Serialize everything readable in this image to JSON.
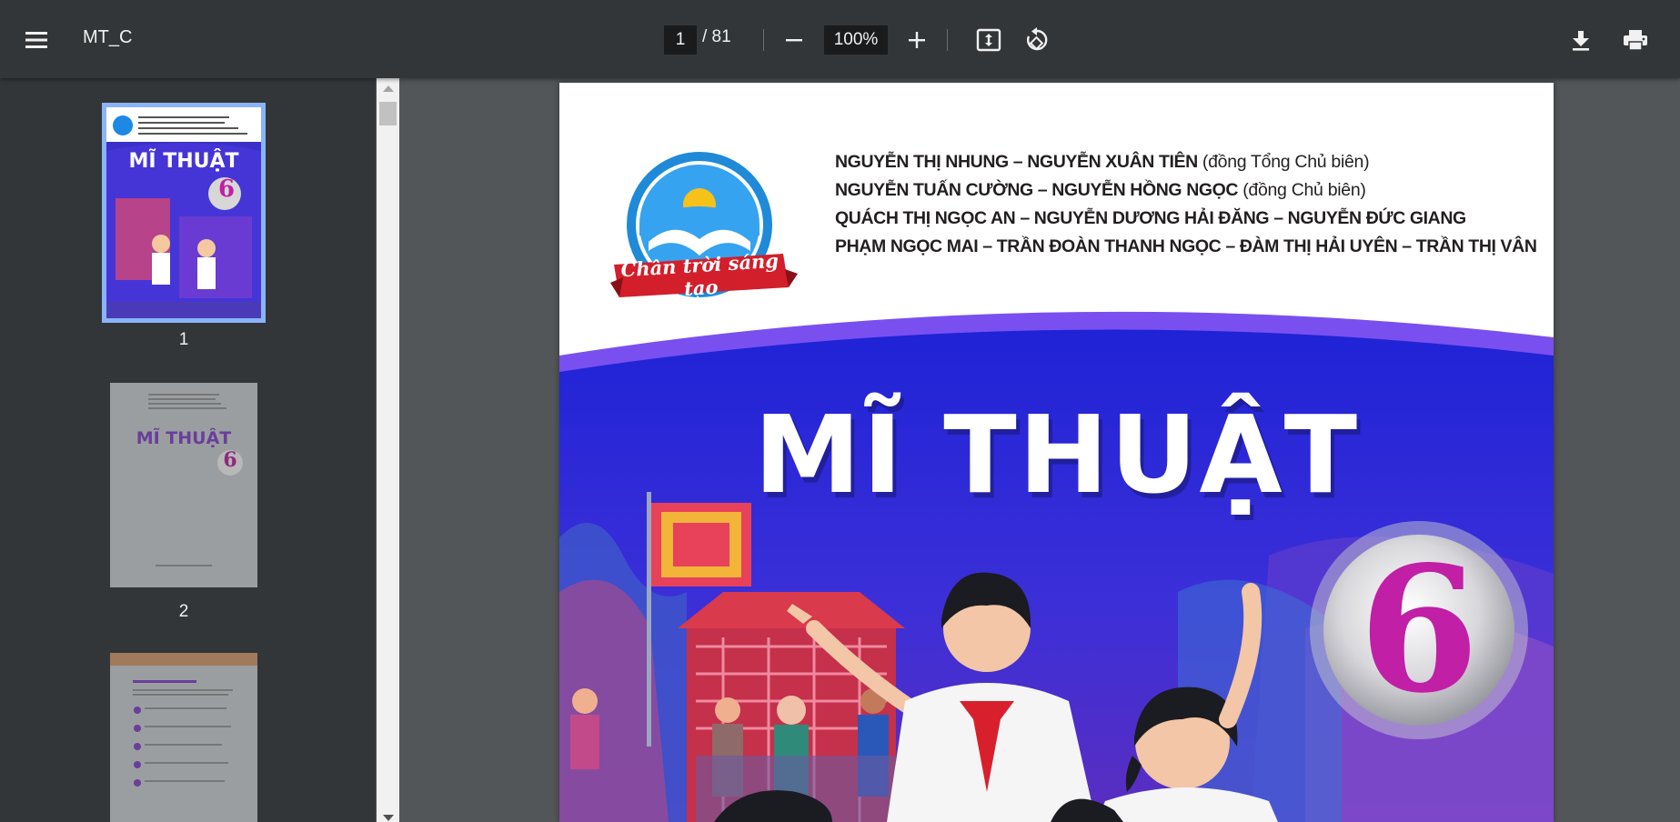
{
  "toolbar": {
    "menu_icon": "hamburger-menu-icon",
    "title": "MT_C",
    "current_page": "1",
    "page_separator": "/ 81",
    "zoom": "100%",
    "zoom_out_icon": "minus-icon",
    "zoom_in_icon": "plus-icon",
    "fit_icon": "fit-to-page-icon",
    "rotate_icon": "rotate-icon",
    "download_icon": "download-icon",
    "print_icon": "print-icon"
  },
  "sidebar": {
    "thumbnails": [
      {
        "label": "1",
        "selected": true,
        "title": "MĨ THUẬT",
        "grade": "6"
      },
      {
        "label": "2",
        "selected": false,
        "title": "MĨ THUẬT",
        "grade": "6"
      },
      {
        "label": "",
        "selected": false
      }
    ]
  },
  "page": {
    "logo_text": "Chân trời sáng tạo",
    "authors": [
      {
        "names": "NGUYỄN THỊ NHUNG – NGUYỄN XUÂN TIÊN",
        "role": " (đồng Tổng Chủ biên)"
      },
      {
        "names": "NGUYỄN TUẤN CƯỜNG – NGUYỄN HỒNG NGỌC",
        "role": " (đồng Chủ biên)"
      },
      {
        "names": "QUÁCH THỊ NGỌC AN – NGUYỄN DƯƠNG HẢI ĐĂNG – NGUYỄN ĐỨC GIANG",
        "role": ""
      },
      {
        "names": "PHẠM NGỌC MAI – TRẦN ĐOÀN THANH NGỌC – ĐÀM THỊ HẢI UYÊN – TRẦN THỊ VÂN",
        "role": ""
      }
    ],
    "cover_title": "MĨ THUẬT",
    "grade": "6"
  },
  "colors": {
    "toolbar_bg": "#323639",
    "viewer_bg": "#525659",
    "cover_blue": "#2a2fd8",
    "cover_purple": "#6a3be0",
    "logo_red": "#d21f2b",
    "grade_magenta": "#c11fa6"
  }
}
